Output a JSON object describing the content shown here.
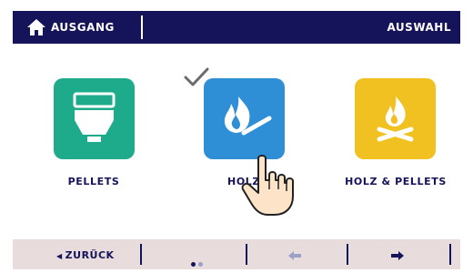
{
  "header": {
    "exit_label": "AUSGANG",
    "select_label": "AUSWAHL",
    "home_icon": "home-icon"
  },
  "options": [
    {
      "label": "PELLETS",
      "icon": "pellet-burner-icon",
      "color": "#1dab8c",
      "selected": false
    },
    {
      "label": "HOLZ",
      "icon": "wood-fire-icon",
      "color": "#2e8ed6",
      "selected": true
    },
    {
      "label": "HOLZ & PELLETS",
      "icon": "wood-and-pellets-icon",
      "color": "#f1c021",
      "selected": false
    }
  ],
  "footer": {
    "back_label": "ZURÜCK",
    "page_indicator": {
      "current": 1,
      "total": 2
    },
    "prev_icon": "arrow-left-icon",
    "next_icon": "arrow-right-icon"
  },
  "colors": {
    "primary": "#15135a",
    "footer_bg": "#e9dcdc",
    "disabled": "#9aa0c8"
  }
}
